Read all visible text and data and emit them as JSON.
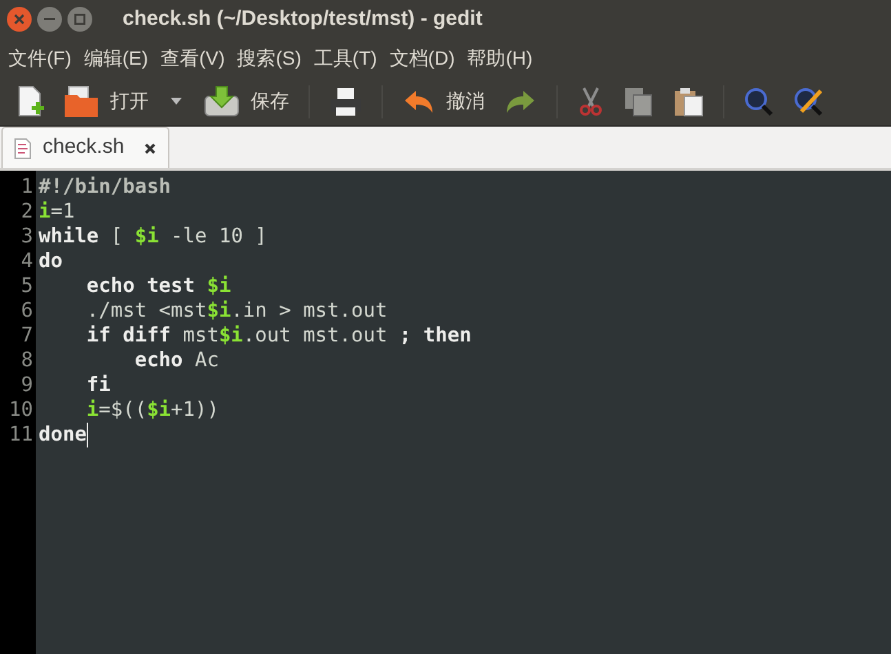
{
  "window": {
    "title": "check.sh (~/Desktop/test/mst) - gedit"
  },
  "menu": [
    "文件(F)",
    "编辑(E)",
    "查看(V)",
    "搜索(S)",
    "工具(T)",
    "文档(D)",
    "帮助(H)"
  ],
  "toolbar": {
    "open_label": "打开",
    "save_label": "保存",
    "undo_label": "撤消"
  },
  "tabs": [
    {
      "label": "check.sh",
      "selected": true
    }
  ],
  "editor": {
    "lines": [
      {
        "number": "1",
        "tokens": [
          {
            "text": "#!/bin/bash",
            "kind": "comment"
          }
        ]
      },
      {
        "number": "2",
        "tokens": [
          {
            "text": "i",
            "kind": "var"
          },
          {
            "text": "=1",
            "kind": "plain"
          }
        ]
      },
      {
        "number": "3",
        "tokens": [
          {
            "text": "while",
            "kind": "keyword"
          },
          {
            "text": " [ ",
            "kind": "plain"
          },
          {
            "text": "$i",
            "kind": "var"
          },
          {
            "text": " -le 10 ]",
            "kind": "plain"
          }
        ]
      },
      {
        "number": "4",
        "tokens": [
          {
            "text": "do",
            "kind": "keyword"
          }
        ]
      },
      {
        "number": "5",
        "tokens": [
          {
            "text": "    echo test ",
            "kind": "keyword"
          },
          {
            "text": "$i",
            "kind": "var"
          }
        ]
      },
      {
        "number": "6",
        "tokens": [
          {
            "text": "    ./mst <mst",
            "kind": "plain"
          },
          {
            "text": "$i",
            "kind": "var"
          },
          {
            "text": ".in > mst.out",
            "kind": "plain"
          }
        ]
      },
      {
        "number": "7",
        "tokens": [
          {
            "text": "    if diff",
            "kind": "keyword"
          },
          {
            "text": " mst",
            "kind": "plain"
          },
          {
            "text": "$i",
            "kind": "var"
          },
          {
            "text": ".out mst.out ",
            "kind": "plain"
          },
          {
            "text": "; then",
            "kind": "keyword"
          }
        ]
      },
      {
        "number": "8",
        "tokens": [
          {
            "text": "        echo",
            "kind": "keyword"
          },
          {
            "text": " Ac",
            "kind": "plain"
          }
        ]
      },
      {
        "number": "9",
        "tokens": [
          {
            "text": "    fi",
            "kind": "keyword"
          }
        ]
      },
      {
        "number": "10",
        "tokens": [
          {
            "text": "    i",
            "kind": "var"
          },
          {
            "text": "=$((",
            "kind": "plain"
          },
          {
            "text": "$i",
            "kind": "var"
          },
          {
            "text": "+1))",
            "kind": "plain"
          }
        ]
      },
      {
        "number": "11",
        "tokens": [
          {
            "text": "done",
            "kind": "keyword"
          }
        ],
        "cursor": true
      }
    ]
  }
}
